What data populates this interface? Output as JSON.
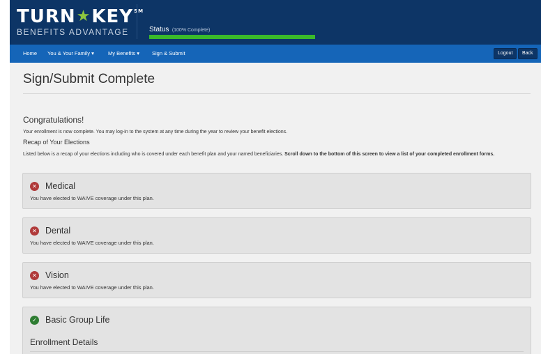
{
  "header": {
    "logo_main_left": "TURN",
    "logo_star": "★",
    "logo_main_right": "KEY",
    "logo_tm": "SM",
    "logo_sub": "BENEFITS ADVANTAGE",
    "status_label": "Status",
    "status_detail": "(100% Complete)",
    "progress_percent": 100,
    "colors": {
      "header_bg": "#0d3566",
      "progress": "#3aba2a",
      "nav_bg": "#1565b8"
    }
  },
  "nav": {
    "items": [
      {
        "label": "Home"
      },
      {
        "label": "You & Your Family ▾"
      },
      {
        "label": "My Benefits ▾"
      },
      {
        "label": "Sign & Submit"
      }
    ],
    "logout_label": "Logout",
    "back_label": "Back"
  },
  "main": {
    "title": "Sign/Submit Complete",
    "congrats": "Congratulations!",
    "complete_note": "Your enrollment is now complete. You may log-in to the system at any time during the year to review your benefit elections.",
    "recap_heading": "Recap of Your Elections",
    "recap_desc": "Listed below is a recap of your elections including who is covered under each benefit plan and your named beneficiaries.",
    "recap_desc_bold": "Scroll down to the bottom of this screen to view a list of your completed enrollment forms.",
    "panels": [
      {
        "title": "Medical",
        "status_icon": "x-circle-icon",
        "body": "You have elected to WAIVE coverage under this plan."
      },
      {
        "title": "Dental",
        "status_icon": "x-circle-icon",
        "body": "You have elected to WAIVE coverage under this plan."
      },
      {
        "title": "Vision",
        "status_icon": "x-circle-icon",
        "body": "You have elected to WAIVE coverage under this plan."
      },
      {
        "title": "Basic Group Life",
        "status_icon": "check-circle-icon",
        "sub_heading": "Enrollment Details"
      }
    ]
  }
}
